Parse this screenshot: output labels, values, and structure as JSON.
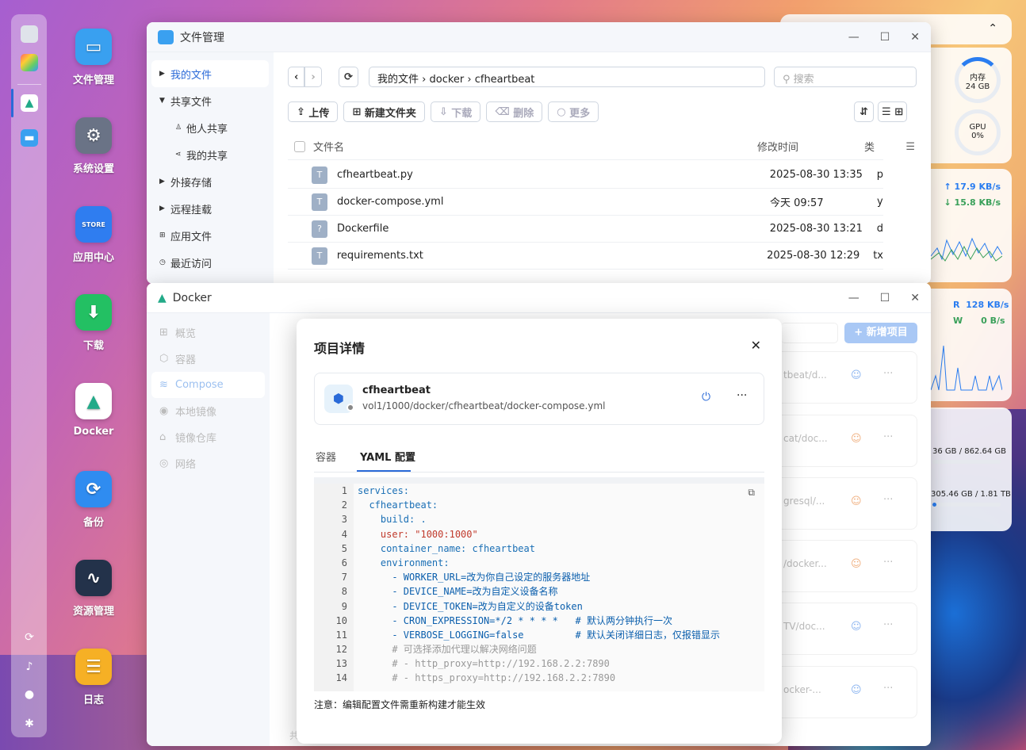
{
  "file_manager": {
    "title": "文件管理",
    "sidebar": [
      {
        "label": "我的文件",
        "icon": "caret-right-icon",
        "active": true
      },
      {
        "label": "共享文件",
        "icon": "caret-down-icon"
      },
      {
        "label": "他人共享",
        "icon": "user-share-icon"
      },
      {
        "label": "我的共享",
        "icon": "share-icon"
      },
      {
        "label": "外接存储",
        "icon": "caret-right-icon"
      },
      {
        "label": "远程挂载",
        "icon": "caret-right-icon"
      },
      {
        "label": "应用文件",
        "icon": "apps-icon"
      },
      {
        "label": "最近访问",
        "icon": "clock-icon"
      }
    ],
    "breadcrumb": [
      "我的文件",
      "docker",
      "cfheartbeat"
    ],
    "search_placeholder": "搜索",
    "toolbar": {
      "upload": "上传",
      "new_folder": "新建文件夹",
      "download": "下载",
      "delete": "删除",
      "more": "更多"
    },
    "columns": {
      "name": "文件名",
      "modified": "修改时间",
      "type": "类"
    },
    "files": [
      {
        "name": "cfheartbeat.py",
        "modified": "2025-08-30 13:35",
        "type": "p",
        "icon": "T"
      },
      {
        "name": "docker-compose.yml",
        "modified": "今天 09:57",
        "type": "y",
        "icon": "T"
      },
      {
        "name": "Dockerfile",
        "modified": "2025-08-30 13:21",
        "type": "d",
        "icon": "?"
      },
      {
        "name": "requirements.txt",
        "modified": "2025-08-30 12:29",
        "type": "tx",
        "icon": "T"
      }
    ]
  },
  "docker": {
    "title": "Docker",
    "sidebar": [
      "概览",
      "容器",
      "Compose",
      "本地镜像",
      "镜像仓库",
      "网络"
    ],
    "new_project": "+ 新增项目",
    "card_paths": [
      "tbeat/d...",
      "cat/doc...",
      "gresql/...",
      "/docker...",
      "TV/doc...",
      "ocker-..."
    ],
    "footer_hint": "共"
  },
  "modal": {
    "title": "项目详情",
    "project_name": "cfheartbeat",
    "project_path": "vol1/1000/docker/cfheartbeat/docker-compose.yml",
    "tabs": [
      "容器",
      "YAML 配置"
    ],
    "active_tab": 1,
    "note": "注意：编辑配置文件需重新构建才能生效"
  },
  "yaml_lines": [
    "services:",
    "  cfheartbeat:",
    "    build: .",
    "    user: \"1000:1000\"",
    "    container_name: cfheartbeat",
    "    environment:",
    "      - WORKER_URL=改为你自己设定的服务器地址",
    "      - DEVICE_NAME=改为自定义设备名称",
    "      - DEVICE_TOKEN=改为自定义的设备token",
    "      - CRON_EXPRESSION=*/2 * * * *   # 默认两分钟执行一次",
    "      - VERBOSE_LOGGING=false         # 默认关闭详细日志，仅报错显示",
    "      # 可选择添加代理以解决网络问题",
    "      # - http_proxy=http://192.168.2.2:7890",
    "      # - https_proxy=http://192.168.2.2:7890"
  ],
  "desktop_icons": [
    "文件管理",
    "系统设置",
    "应用中心",
    "下载",
    "Docker",
    "备份",
    "资源管理",
    "日志"
  ],
  "widgets": {
    "memory_label": "内存",
    "memory_value": "24 GB",
    "gpu_label": "GPU",
    "gpu_value": "0%",
    "net_up": "17.9 KB/s",
    "net_down": "15.8 KB/s",
    "disk_r_label": "R",
    "disk_r": "128 KB/s",
    "disk_w_label": "W",
    "disk_w": "0 B/s",
    "storage1": "36 GB / 862.64 GB",
    "storage2": "305.46 GB / 1.81 TB",
    "memory_pct": 0.3
  },
  "store_label": "STORE"
}
